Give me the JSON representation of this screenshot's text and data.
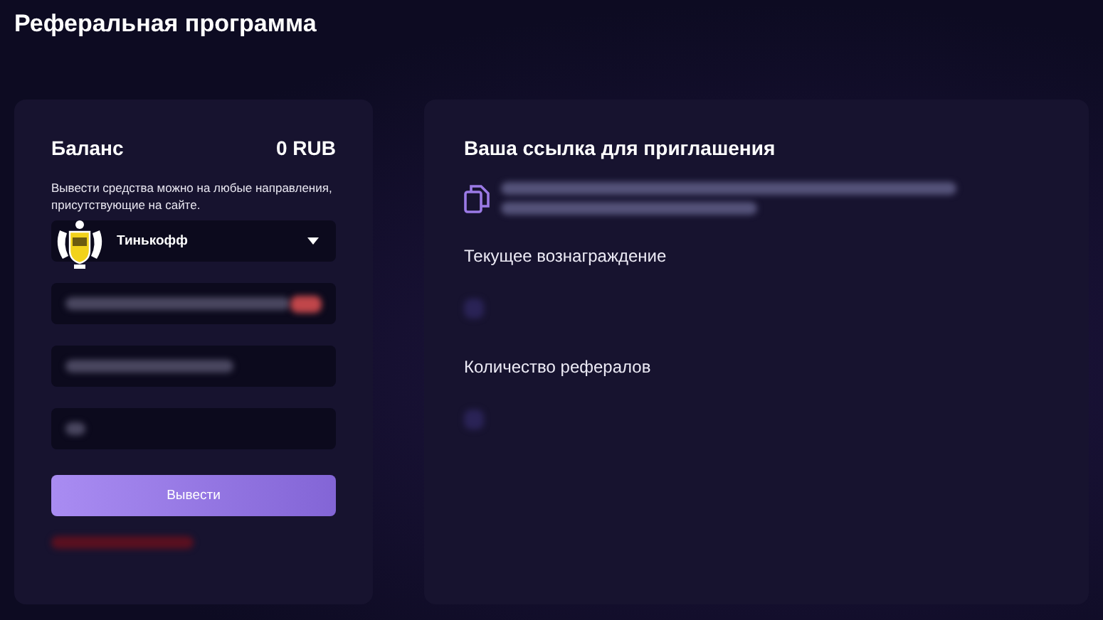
{
  "page_title": "Реферальная программа",
  "balance_card": {
    "title": "Баланс",
    "amount": "0 RUB",
    "note": "Вывести средства можно на любые направления, присутствующие на сайте.",
    "bank": "Тинькофф",
    "button": "Вывести"
  },
  "invite_card": {
    "title": "Ваша ссылка для приглашения",
    "reward_label": "Текущее вознаграждение",
    "referrals_label": "Количество рефералов"
  }
}
